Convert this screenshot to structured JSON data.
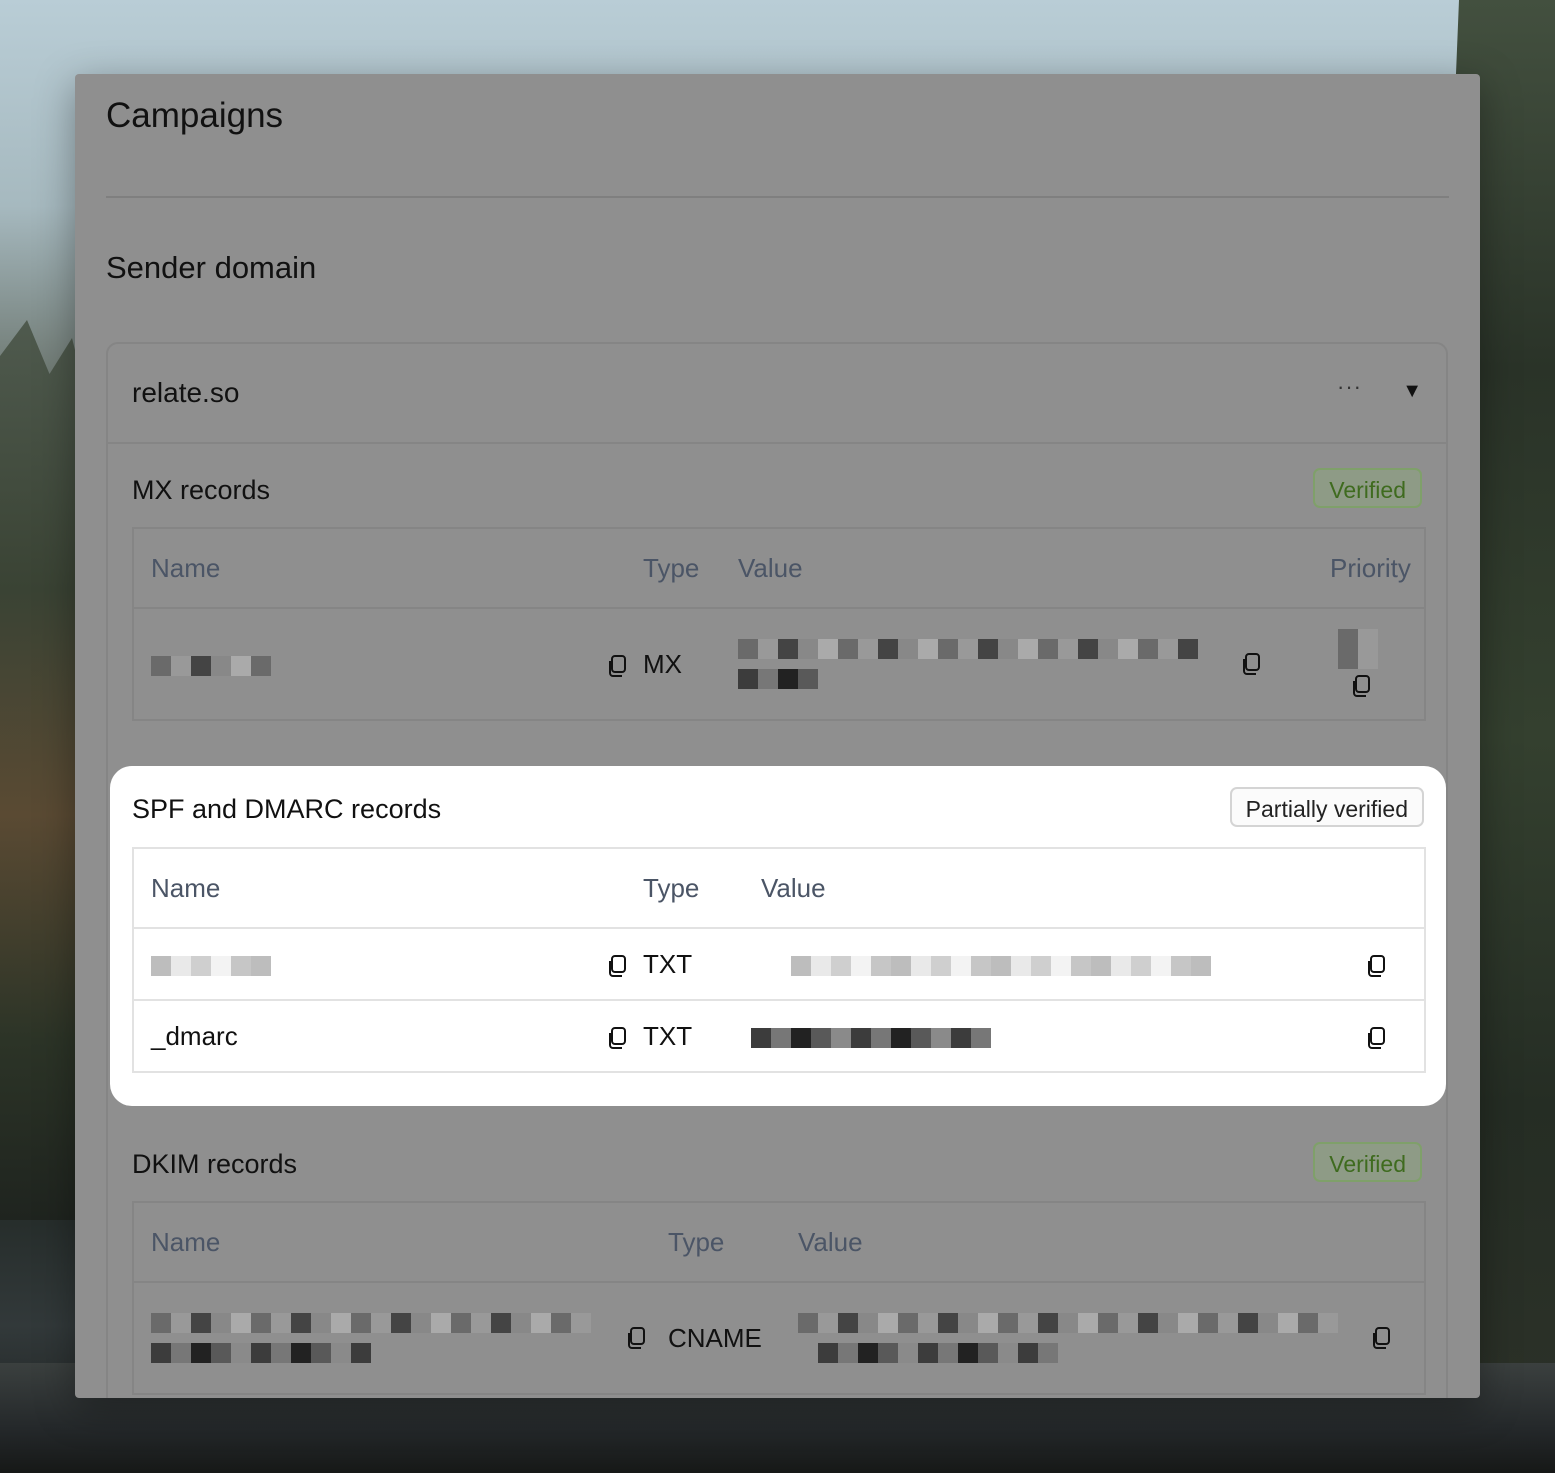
{
  "window": {
    "title": "Campaigns"
  },
  "sender_domain": {
    "title": "Sender domain",
    "domain": "relate.so",
    "more_icon": "more-icon",
    "expand_icon": "caret-down-icon"
  },
  "mx": {
    "title": "MX records",
    "status": "Verified",
    "headers": {
      "name": "Name",
      "type": "Type",
      "value": "Value",
      "priority": "Priority"
    },
    "rows": [
      {
        "type": "MX"
      }
    ]
  },
  "spf": {
    "title": "SPF and DMARC records",
    "status": "Partially verified",
    "headers": {
      "name": "Name",
      "type": "Type",
      "value": "Value"
    },
    "rows": [
      {
        "name": "",
        "type": "TXT"
      },
      {
        "name": "_dmarc",
        "type": "TXT"
      }
    ]
  },
  "dkim": {
    "title": "DKIM records",
    "status": "Verified",
    "headers": {
      "name": "Name",
      "type": "Type",
      "value": "Value"
    },
    "rows": [
      {
        "type": "CNAME"
      }
    ]
  },
  "colors": {
    "verified_text": "#3f6b1f",
    "verified_border": "#7fa06a",
    "header_text": "#4b5566",
    "highlight_bg": "#ffffff",
    "dim_overlay": "#8f8f8f"
  }
}
